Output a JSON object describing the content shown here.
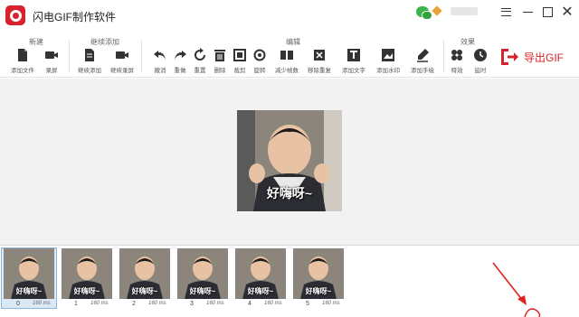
{
  "window": {
    "title": "闪电GIF制作软件"
  },
  "toolbar": {
    "groups": [
      {
        "label": "新建",
        "tools": [
          {
            "label": "添加文件",
            "icon": "add-file-icon"
          },
          {
            "label": "录屏",
            "icon": "record-icon"
          }
        ]
      },
      {
        "label": "继续添加",
        "tools": [
          {
            "label": "继续添加",
            "icon": "continue-add-icon"
          },
          {
            "label": "继续录屏",
            "icon": "continue-record-icon"
          }
        ]
      },
      {
        "label": "编辑",
        "tools": [
          {
            "label": "撤消",
            "icon": "undo-icon"
          },
          {
            "label": "重做",
            "icon": "redo-icon"
          },
          {
            "label": "重置",
            "icon": "reset-icon"
          },
          {
            "label": "删除",
            "icon": "delete-icon"
          },
          {
            "label": "裁剪",
            "icon": "crop-icon"
          },
          {
            "label": "旋转",
            "icon": "rotate-icon"
          },
          {
            "label": "减少帧数",
            "icon": "reduce-frames-icon"
          },
          {
            "label": "移除重复",
            "icon": "remove-duplicates-icon"
          },
          {
            "label": "添加文字",
            "icon": "add-text-icon"
          },
          {
            "label": "添加水印",
            "icon": "add-watermark-icon"
          },
          {
            "label": "添加手绘",
            "icon": "add-drawing-icon"
          }
        ]
      },
      {
        "label": "效果",
        "tools": [
          {
            "label": "特效",
            "icon": "effects-icon"
          },
          {
            "label": "延时",
            "icon": "delay-icon"
          }
        ]
      }
    ],
    "export_label": "导出GIF"
  },
  "colors": {
    "brand": "#d7232b",
    "icon": "#333333",
    "canvas_bg": "#f2f2f2"
  },
  "preview": {
    "caption": "好嗨呀~"
  },
  "frames": [
    {
      "index": "0",
      "duration": "160 ms",
      "caption": "好嗨呀~",
      "selected": true
    },
    {
      "index": "1",
      "duration": "160 ms",
      "caption": "好嗨呀~"
    },
    {
      "index": "2",
      "duration": "160 ms",
      "caption": "好嗨呀~"
    },
    {
      "index": "3",
      "duration": "160 ms",
      "caption": "好嗨呀~"
    },
    {
      "index": "4",
      "duration": "160 ms",
      "caption": "好嗨呀~"
    },
    {
      "index": "5",
      "duration": "160 ms",
      "caption": "好嗨呀~"
    }
  ]
}
